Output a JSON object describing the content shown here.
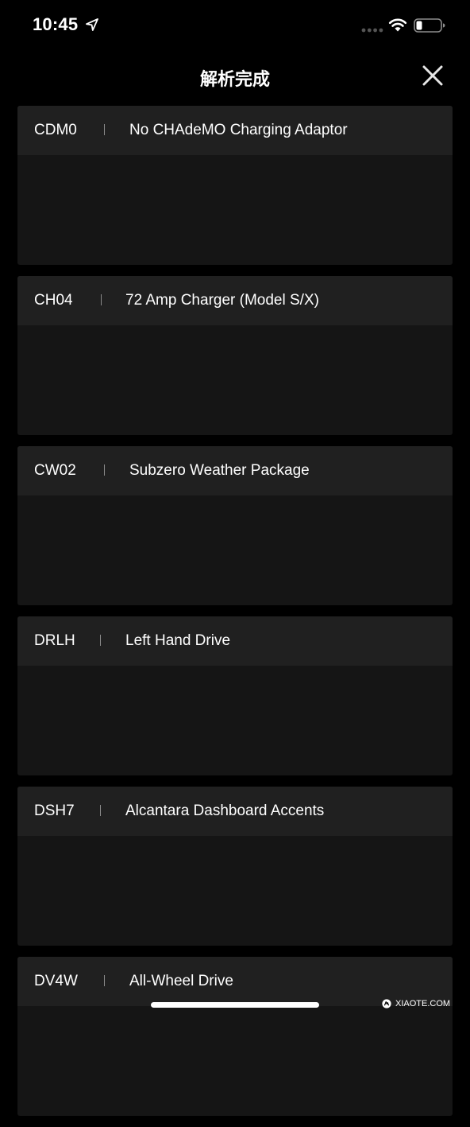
{
  "status_bar": {
    "time": "10:45",
    "icons": [
      "location-arrow-icon",
      "cellular-signal-icon",
      "wifi-icon",
      "battery-icon"
    ]
  },
  "nav": {
    "title": "解析完成",
    "close_icon": "close-icon"
  },
  "options": [
    {
      "code": "CDM0",
      "description": "No CHAdeMO Charging Adaptor"
    },
    {
      "code": "CH04",
      "description": "72 Amp Charger (Model S/X)"
    },
    {
      "code": "CW02",
      "description": "Subzero Weather Package"
    },
    {
      "code": "DRLH",
      "description": "Left Hand Drive"
    },
    {
      "code": "DSH7",
      "description": "Alcantara Dashboard Accents"
    },
    {
      "code": "DV4W",
      "description": "All-Wheel Drive"
    }
  ],
  "watermark": {
    "text": "XIAOTE.COM"
  },
  "colors": {
    "background": "#000000",
    "card": "#151515",
    "card_header": "#202020",
    "text": "#ffffff"
  }
}
